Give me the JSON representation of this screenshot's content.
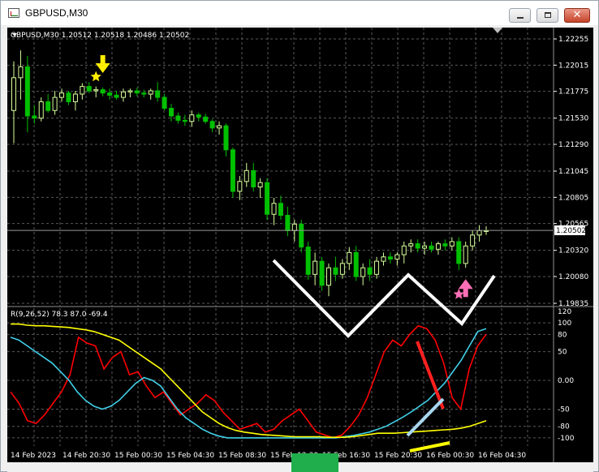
{
  "window": {
    "title": "GBPUSD,M30",
    "icons": {
      "app": "chart-app-icon",
      "minimize": "minimize-icon",
      "maximize": "maximize-icon",
      "close": "close-icon"
    },
    "close_glyph": "✕"
  },
  "colors": {
    "background": "#000000",
    "grid": "#5a5a5a",
    "axis_text": "#ffffff",
    "bull_candle": "#d7ff9a",
    "bear_candle": "#00c000",
    "price_line": "#999999",
    "rsi_red": "#ff0000",
    "rsi_cyan": "#40d0e8",
    "rsi_yellow": "#ffff00",
    "arrow_down": "#ffee00",
    "arrow_up": "#ff6fb5",
    "green_block": "#1fae4b"
  },
  "main": {
    "header": "GBPUSD,M30  1.20512 1.20518 1.20486 1.20502",
    "price_ticks": [
      "1.22255",
      "1.22015",
      "1.21775",
      "1.21530",
      "1.21290",
      "1.21045",
      "1.20805",
      "1.20565",
      "1.20320",
      "1.20080",
      "1.19835"
    ],
    "current_price": "1.20502"
  },
  "indicator": {
    "header": "R(9,26,52) 78.3 87.0 -69.4",
    "ticks": [
      "120",
      "100",
      "80",
      "50",
      "0.00",
      "-50",
      "-80",
      "-100"
    ]
  },
  "time_labels": [
    "14 Feb 2023",
    "14 Feb 20:30",
    "15 Feb 00:30",
    "15 Feb 04:30",
    "15 Feb 08:30",
    "15 Feb 12:30",
    "15 Feb 16:30",
    "15 Feb 20:30",
    "16 Feb 00:30",
    "16 Feb 04:30"
  ],
  "chart_data": {
    "type": "candlestick",
    "symbol": "GBPUSD",
    "timeframe": "M30",
    "ylim": [
      1.19835,
      1.22255
    ],
    "candles": [
      [
        1.216,
        1.2205,
        1.213,
        1.219
      ],
      [
        1.219,
        1.2215,
        1.217,
        1.22
      ],
      [
        1.22,
        1.221,
        1.214,
        1.2155
      ],
      [
        1.2155,
        1.2165,
        1.2148,
        1.2153
      ],
      [
        1.2153,
        1.2172,
        1.215,
        1.2168
      ],
      [
        1.2168,
        1.2175,
        1.2158,
        1.216
      ],
      [
        1.216,
        1.2178,
        1.2156,
        1.2172
      ],
      [
        1.2172,
        1.218,
        1.2168,
        1.2176
      ],
      [
        1.2176,
        1.2178,
        1.2165,
        1.2168
      ],
      [
        1.2168,
        1.2178,
        1.216,
        1.2175
      ],
      [
        1.2175,
        1.2185,
        1.217,
        1.2182
      ],
      [
        1.2182,
        1.2186,
        1.2176,
        1.2178
      ],
      [
        1.2178,
        1.2182,
        1.2172,
        1.2179
      ],
      [
        1.2179,
        1.2181,
        1.2173,
        1.2176
      ],
      [
        1.2176,
        1.218,
        1.217,
        1.2174
      ],
      [
        1.2174,
        1.2178,
        1.217,
        1.2172
      ],
      [
        1.2172,
        1.218,
        1.2168,
        1.2177
      ],
      [
        1.2177,
        1.218,
        1.2172,
        1.2178
      ],
      [
        1.2178,
        1.2181,
        1.2173,
        1.2176
      ],
      [
        1.2176,
        1.2179,
        1.2172,
        1.2175
      ],
      [
        1.2175,
        1.218,
        1.217,
        1.2178
      ],
      [
        1.2178,
        1.2186,
        1.2168,
        1.2172
      ],
      [
        1.2172,
        1.2175,
        1.216,
        1.2162
      ],
      [
        1.2162,
        1.2166,
        1.215,
        1.2155
      ],
      [
        1.2155,
        1.2158,
        1.2148,
        1.2151
      ],
      [
        1.2151,
        1.2156,
        1.2146,
        1.215
      ],
      [
        1.215,
        1.216,
        1.2145,
        1.2156
      ],
      [
        1.2156,
        1.2158,
        1.215,
        1.2154
      ],
      [
        1.2154,
        1.2157,
        1.2148,
        1.215
      ],
      [
        1.215,
        1.2152,
        1.214,
        1.2144
      ],
      [
        1.2144,
        1.215,
        1.2138,
        1.2146
      ],
      [
        1.2146,
        1.2148,
        1.2118,
        1.2124
      ],
      [
        1.2124,
        1.2126,
        1.208,
        1.2086
      ],
      [
        1.2086,
        1.21,
        1.2078,
        1.2095
      ],
      [
        1.2095,
        1.2112,
        1.209,
        1.2105
      ],
      [
        1.2105,
        1.2112,
        1.2086,
        1.209
      ],
      [
        1.209,
        1.2098,
        1.208,
        1.2094
      ],
      [
        1.2094,
        1.2098,
        1.206,
        1.2065
      ],
      [
        1.2065,
        1.208,
        1.2055,
        1.2075
      ],
      [
        1.2075,
        1.2082,
        1.206,
        1.2064
      ],
      [
        1.2064,
        1.2072,
        1.2045,
        1.205
      ],
      [
        1.205,
        1.206,
        1.204,
        1.2056
      ],
      [
        1.2056,
        1.206,
        1.203,
        1.2035
      ],
      [
        1.2035,
        1.204,
        1.2005,
        1.201
      ],
      [
        1.201,
        1.203,
        1.2,
        1.2022
      ],
      [
        1.2022,
        1.2026,
        1.1995,
        1.2
      ],
      [
        1.2,
        1.202,
        1.199,
        1.2016
      ],
      [
        1.2016,
        1.2026,
        1.2004,
        1.201
      ],
      [
        1.201,
        1.2024,
        1.2006,
        1.202
      ],
      [
        1.202,
        1.2035,
        1.2014,
        1.203
      ],
      [
        1.203,
        1.2036,
        1.2004,
        1.2008
      ],
      [
        1.2008,
        1.202,
        1.2,
        1.2016
      ],
      [
        1.2016,
        1.2024,
        1.2004,
        1.201
      ],
      [
        1.201,
        1.2026,
        1.2006,
        1.2022
      ],
      [
        1.2022,
        1.203,
        1.2018,
        1.2026
      ],
      [
        1.2026,
        1.203,
        1.202,
        1.2024
      ],
      [
        1.2024,
        1.203,
        1.2018,
        1.2028
      ],
      [
        1.2028,
        1.204,
        1.202,
        1.2036
      ],
      [
        1.2036,
        1.2042,
        1.203,
        1.2038
      ],
      [
        1.2038,
        1.2042,
        1.203,
        1.2034
      ],
      [
        1.2034,
        1.204,
        1.2028,
        1.2036
      ],
      [
        1.2036,
        1.204,
        1.203,
        1.2033
      ],
      [
        1.2033,
        1.204,
        1.2028,
        1.2038
      ],
      [
        1.2038,
        1.2042,
        1.2032,
        1.2036
      ],
      [
        1.2036,
        1.2044,
        1.2032,
        1.204
      ],
      [
        1.204,
        1.2044,
        1.2014,
        1.202
      ],
      [
        1.202,
        1.204,
        1.2016,
        1.2036
      ],
      [
        1.2036,
        1.205,
        1.2032,
        1.2046
      ],
      [
        1.2046,
        1.2055,
        1.204,
        1.205
      ],
      [
        1.205,
        1.2054,
        1.2046,
        1.205
      ]
    ],
    "indicator": {
      "name": "R(9,26,52)",
      "ylim": [
        -110,
        120
      ],
      "series": [
        {
          "name": "9",
          "values": [
            -20,
            -40,
            -70,
            -75,
            -60,
            -40,
            -20,
            10,
            75,
            65,
            60,
            20,
            40,
            50,
            10,
            15,
            -10,
            -30,
            -20,
            -40,
            -60,
            -50,
            -40,
            -25,
            -35,
            -55,
            -70,
            -85,
            -80,
            -75,
            -90,
            -85,
            -70,
            -60,
            -50,
            -70,
            -90,
            -95,
            -100,
            -95,
            -80,
            -60,
            -30,
            10,
            50,
            70,
            60,
            80,
            95,
            90,
            70,
            30,
            -30,
            -50,
            20,
            60,
            80
          ]
        },
        {
          "name": "26",
          "values": [
            75,
            70,
            60,
            50,
            40,
            30,
            15,
            0,
            -20,
            -35,
            -45,
            -50,
            -45,
            -35,
            -20,
            -5,
            5,
            0,
            -10,
            -30,
            -50,
            -65,
            -75,
            -85,
            -92,
            -97,
            -100,
            -100,
            -100,
            -100,
            -100,
            -100,
            -100,
            -100,
            -100,
            -100,
            -100,
            -100,
            -100,
            -100,
            -98,
            -96,
            -93,
            -90,
            -85,
            -80,
            -72,
            -64,
            -55,
            -45,
            -35,
            -20,
            -5,
            15,
            35,
            60,
            85,
            90
          ]
        },
        {
          "name": "52",
          "values": [
            98,
            98,
            96,
            95,
            95,
            94,
            93,
            92,
            90,
            88,
            85,
            80,
            75,
            70,
            60,
            50,
            40,
            30,
            20,
            5,
            -10,
            -25,
            -40,
            -55,
            -65,
            -75,
            -82,
            -87,
            -90,
            -92,
            -94,
            -95,
            -96,
            -97,
            -98,
            -98,
            -98,
            -98,
            -99,
            -99,
            -99,
            -98,
            -96,
            -94,
            -92,
            -92,
            -92,
            -91,
            -90,
            -89,
            -88,
            -87,
            -86,
            -85,
            -83,
            -80,
            -75,
            -70
          ]
        }
      ]
    },
    "markers": [
      {
        "type": "arrow-down",
        "name": "sell-signal",
        "candle": 13,
        "color": "yellow"
      },
      {
        "type": "star",
        "name": "sell-star",
        "candle": 12,
        "color": "yellow"
      },
      {
        "type": "arrow-up",
        "name": "buy-signal",
        "candle": 66,
        "color": "pink"
      },
      {
        "type": "star",
        "name": "buy-star",
        "candle": 65,
        "color": "pink"
      }
    ]
  }
}
